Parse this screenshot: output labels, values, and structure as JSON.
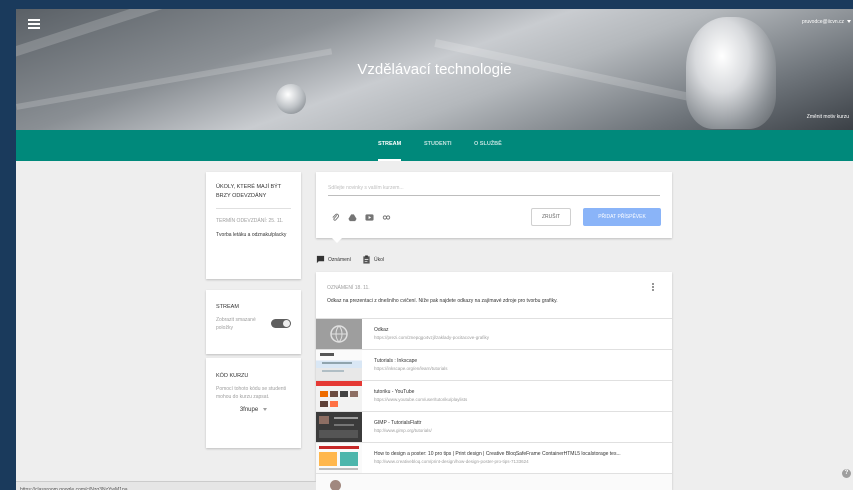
{
  "header": {
    "account": "pruvodce@iicvn.cz",
    "class_title": "Vzdělávací technologie",
    "change_theme": "Změnit motiv kurzu"
  },
  "tabs": [
    {
      "label": "STREAM"
    },
    {
      "label": "STUDENTI"
    },
    {
      "label": "O SLUŽBĚ"
    }
  ],
  "upcoming": {
    "title": "ÚKOLY, KTERÉ MAJÍ BÝT BRZY ODEVZDÁNY",
    "due": "TERMÍN ODEVZDÁNÍ: 25. 11.",
    "task": "Tvorba letáku a odznaku/placky"
  },
  "stream_settings": {
    "title": "STREAM",
    "description": "Zobrazit smazané položky"
  },
  "class_code": {
    "title": "KÓD KURZU",
    "description": "Pomocí tohoto kódu se studenti mohou do kurzu zapsat.",
    "code": "3fnupe"
  },
  "share": {
    "placeholder": "Sdílejte novinky s vaším kurzem...",
    "cancel_label": "ZRUŠIT",
    "post_label": "PŘIDAT PŘÍSPĚVEK",
    "type_announcement": "Oznámení",
    "type_assignment": "Úkol"
  },
  "post": {
    "meta": "OZNÁMENÍ 18. 11.",
    "text": "Odkaz na prezentaci z dnešního cvičení. Níže pak najdete odkazy na zajímavé zdroje pro tvorbu grafiky.",
    "attachments": [
      {
        "title": "Odkaz",
        "url": "https://prezi.com/2nepqgo4vzjl/zaklady-pocitacove-grafiky"
      },
      {
        "title": "Tutorials : Inkscape",
        "url": "https://inkscape.org/en/learn/tutorials"
      },
      {
        "title": "tutoriku - YouTube",
        "url": "https://www.youtube.com/user/tutoriku/playlists"
      },
      {
        "title": "GIMP - TutorialsFlattr",
        "url": "http://www.gimp.org/tutorials/"
      },
      {
        "title": "How to design a poster: 10 pro tips | Print design | Creative BloqSafeFrame ContainerHTML5 localstorage tes...",
        "url": "http://www.creativebloq.com/print-design/how-design-poster-pro-tips-7133624"
      }
    ]
  },
  "status_url": "https://classroom.google.com/c/Nzg3NzYwM1pa",
  "colors": {
    "teal": "#00897b",
    "primary_button": "#8ab4f8"
  }
}
